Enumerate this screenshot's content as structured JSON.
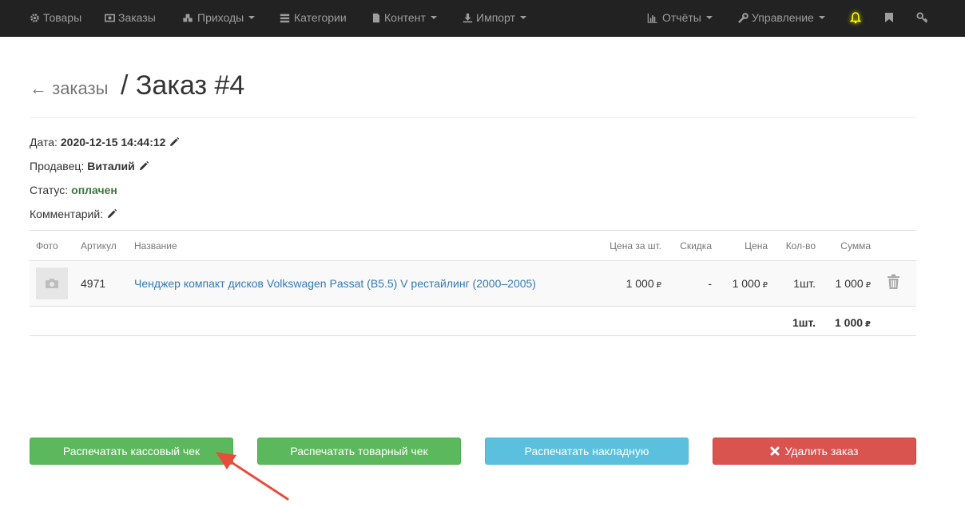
{
  "navbar": {
    "left_items": [
      {
        "label": "Товары",
        "icon": "gear-icon",
        "dropdown": false
      },
      {
        "label": "Заказы",
        "icon": "money-icon",
        "dropdown": false
      },
      {
        "label": "Приходы",
        "icon": "cubes-icon",
        "dropdown": true
      },
      {
        "label": "Категории",
        "icon": "list-icon",
        "dropdown": false
      },
      {
        "label": "Контент",
        "icon": "file-icon",
        "dropdown": true
      },
      {
        "label": "Импорт",
        "icon": "download-icon",
        "dropdown": true
      }
    ],
    "right_items": [
      {
        "label": "Отчёты",
        "icon": "bar-chart-icon",
        "dropdown": true
      },
      {
        "label": "Управление",
        "icon": "wrench-icon",
        "dropdown": true
      }
    ],
    "icon_buttons": [
      "bell-icon",
      "bookmark-icon",
      "key-icon"
    ],
    "colors": {
      "background": "#222222",
      "text": "#9d9d9d",
      "bell": "#ffff00"
    }
  },
  "header": {
    "back_label": "← заказы",
    "title": "/ Заказ #4"
  },
  "order": {
    "date_label": "Дата:",
    "date_value": "2020-12-15 14:44:12",
    "seller_label": "Продавец:",
    "seller_value": "Виталий",
    "status_label": "Статус:",
    "status_value": "оплачен",
    "comment_label": "Комментарий:"
  },
  "table": {
    "headers": [
      "Фото",
      "Артикул",
      "Название",
      "Цена за шт.",
      "Скидка",
      "Цена",
      "Кол-во",
      "Сумма"
    ],
    "rows": [
      {
        "article": "4971",
        "name": "Ченджер компакт дисков Volkswagen Passat (B5.5) V рестайлинг (2000–2005)",
        "unit_price": "1 000",
        "discount": "-",
        "price": "1 000",
        "qty": "1шт.",
        "sum": "1 000"
      }
    ],
    "currency": "₽",
    "total": {
      "qty": "1шт.",
      "sum": "1 000"
    }
  },
  "buttons": {
    "print_receipt": "Распечатать кассовый чек",
    "print_sales_receipt": "Распечатать товарный чек",
    "print_invoice": "Распечатать накладную",
    "delete_order": "Удалить заказ"
  },
  "colors": {
    "success": "#5cb85c",
    "info": "#5bc0de",
    "danger": "#d9534f",
    "link": "#337ab7",
    "status_green": "#3c763d",
    "annotation_arrow": "#e74c3c"
  }
}
